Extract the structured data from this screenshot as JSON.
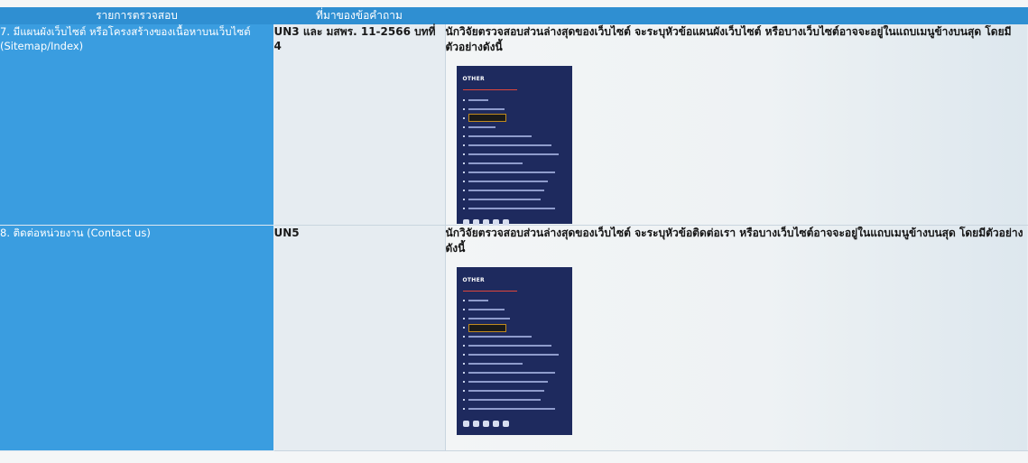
{
  "table": {
    "headers": [
      "รายการตรวจสอบ",
      "ที่มาของข้อคำถาม",
      ""
    ],
    "rows": [
      {
        "item": "7. มีแผนผังเว็บไซต์ หรือโครงสร้างของเนื้อหาบนเว็บไซต์ (Sitemap/Index)",
        "source": "UN3 และ มสพร. 11-2566 บทที่ 4",
        "detail": "นักวิจัยตรวจสอบส่วนล่างสุดของเว็บไซต์ จะระบุหัวข้อแผนผังเว็บไซต์  หรือบางเว็บไซต์อาจจะอยู่ในแถบเมนูข้างบนสุด โดยมีตัวอย่างดังนี้",
        "screenshot": {
          "heading": "OTHER",
          "link_count": 13,
          "highlighted_index": 2,
          "social_icons": [
            "facebook-icon",
            "twitter-icon",
            "youtube-icon",
            "instagram-icon",
            "line-icon"
          ]
        }
      },
      {
        "item": "8. ติดต่อหน่วยงาน (Contact us)",
        "source": "UN5",
        "detail": "นักวิจัยตรวจสอบส่วนล่างสุดของเว็บไซต์ จะระบุหัวข้อติดต่อเรา หรือบางเว็บไซต์อาจจะอยู่ในแถบเมนูข้างบนสุด โดยมีตัวอย่างดังนี้",
        "screenshot": {
          "heading": "OTHER",
          "link_count": 13,
          "highlighted_index": 3,
          "social_icons": [
            "facebook-icon",
            "twitter-icon",
            "youtube-icon",
            "instagram-icon",
            "line-icon"
          ]
        }
      }
    ]
  },
  "colors": {
    "header_bg": "#2f8fd2",
    "item_col_bg": "#3a9de0",
    "source_col_bg": "#e6ecf1",
    "screenshot_bg": "#1e2a5e",
    "screenshot_rule": "#e0463b",
    "highlight_border": "#c08a1f"
  }
}
